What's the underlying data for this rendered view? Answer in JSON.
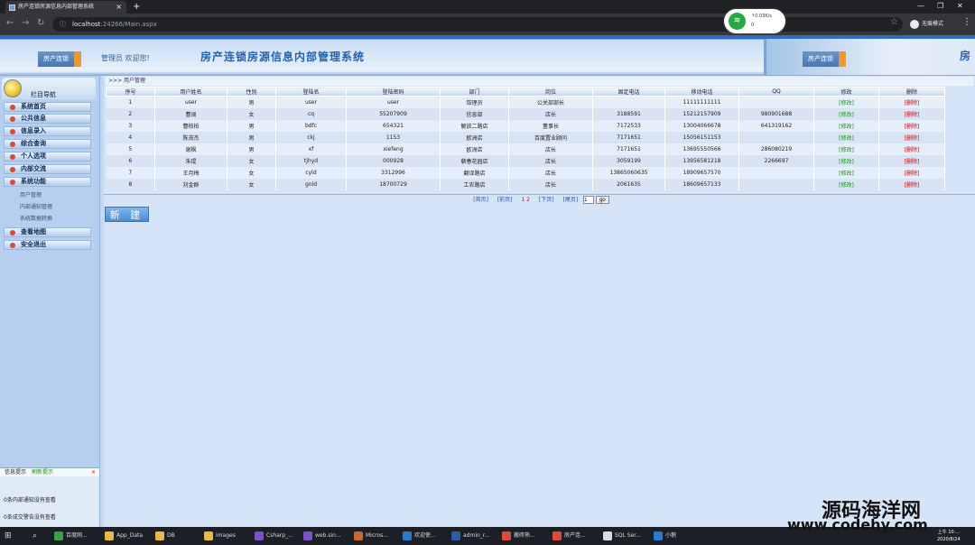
{
  "browser": {
    "tab_title": "房产连锁房源信息内部管理系统",
    "url_scheme": "localhost",
    "url_path": ":24266/Main.aspx",
    "incognito_label": "无痕模式",
    "net_speed": "↑0.03K/s",
    "net_down": "0"
  },
  "banner": {
    "logo_left": "房产连锁",
    "welcome": "管理员 欢迎您!",
    "title": "房产连锁房源信息内部管理系统",
    "logo_right": "房产连锁"
  },
  "sidebar": {
    "header": "栏目导航",
    "menus": [
      "系统首页",
      "公共信息",
      "信息录入",
      "综合查询",
      "个人选项",
      "内部交流",
      "系统功能"
    ],
    "submenus": [
      "用户管理",
      "内部通知管理",
      "系统数据转换"
    ],
    "menus_after": [
      "查看地图",
      "安全退出"
    ]
  },
  "messages": {
    "head1": "信息提示",
    "head2": "刷新提示",
    "line1": "0条内部通知没有查看",
    "line2": "0条成交警告没有查看"
  },
  "main": {
    "breadcrumb": ">>> 用户管理",
    "columns": [
      "序号",
      "用户姓名",
      "性别",
      "登陆名",
      "登陆密码",
      "部门",
      "岗位",
      "固定电话",
      "移动电话",
      "QQ",
      "修改",
      "删除"
    ],
    "rows": [
      [
        "1",
        "user",
        "男",
        "user",
        "user",
        "馆理员",
        "公关部部长",
        "",
        "11111111111",
        "",
        "[修改]",
        "[删除]"
      ],
      [
        "2",
        "曹阔",
        "女",
        "cq",
        "55207909",
        "信息部",
        "店长",
        "3188591",
        "15212157909",
        "980901688",
        "[修改]",
        "[删除]"
      ],
      [
        "3",
        "曹柏柏",
        "男",
        "bdfc",
        "654321",
        "解放二路店",
        "董事长",
        "7172533",
        "13004066678",
        "641319162",
        "[修改]",
        "[删除]"
      ],
      [
        "4",
        "陈茂杰",
        "男",
        "ckj",
        "1153",
        "欧洲店",
        "百度置业顾问",
        "7171651",
        "15056151153",
        "",
        "[修改]",
        "[删除]"
      ],
      [
        "5",
        "谢枫",
        "男",
        "xf",
        "xiefeng",
        "欧洲店",
        "店长",
        "7171651",
        "13695550566",
        "286080219",
        "[修改]",
        "[删除]"
      ],
      [
        "6",
        "朱琨",
        "女",
        "tjhyd",
        "000928",
        "蕲春花园店",
        "店长",
        "3059199",
        "13956581218",
        "2266697",
        "[修改]",
        "[删除]"
      ],
      [
        "7",
        "王月梅",
        "女",
        "cyld",
        "3312996",
        "翻译路店",
        "店长",
        "13865060635",
        "18909657570",
        "",
        "[修改]",
        "[删除]"
      ],
      [
        "8",
        "刘金群",
        "女",
        "gnld",
        "18700729",
        "工农路店",
        "店长",
        "2061635",
        "18609657133",
        "",
        "[修改]",
        "[删除]"
      ]
    ],
    "pager": {
      "first": "[首页]",
      "prev": "[前页]",
      "pages": "1 2",
      "next": "[下页]",
      "last": "[尾页]",
      "page_value": "1",
      "go": "go"
    },
    "new_button": "新 建"
  },
  "taskbar": {
    "items": [
      "百度网...",
      "App_Data",
      "DB",
      "images",
      "Csharp_...",
      "web.sin...",
      "Micros...",
      "欢迎使...",
      "admin_r...",
      "搬砖熟...",
      "房产连...",
      "SQL Ser...",
      "小鹅"
    ],
    "time": "上午 10:...",
    "date": "2020/8/24"
  },
  "watermark": {
    "line1": "源码海洋网",
    "line2": "www.codehy.com"
  }
}
